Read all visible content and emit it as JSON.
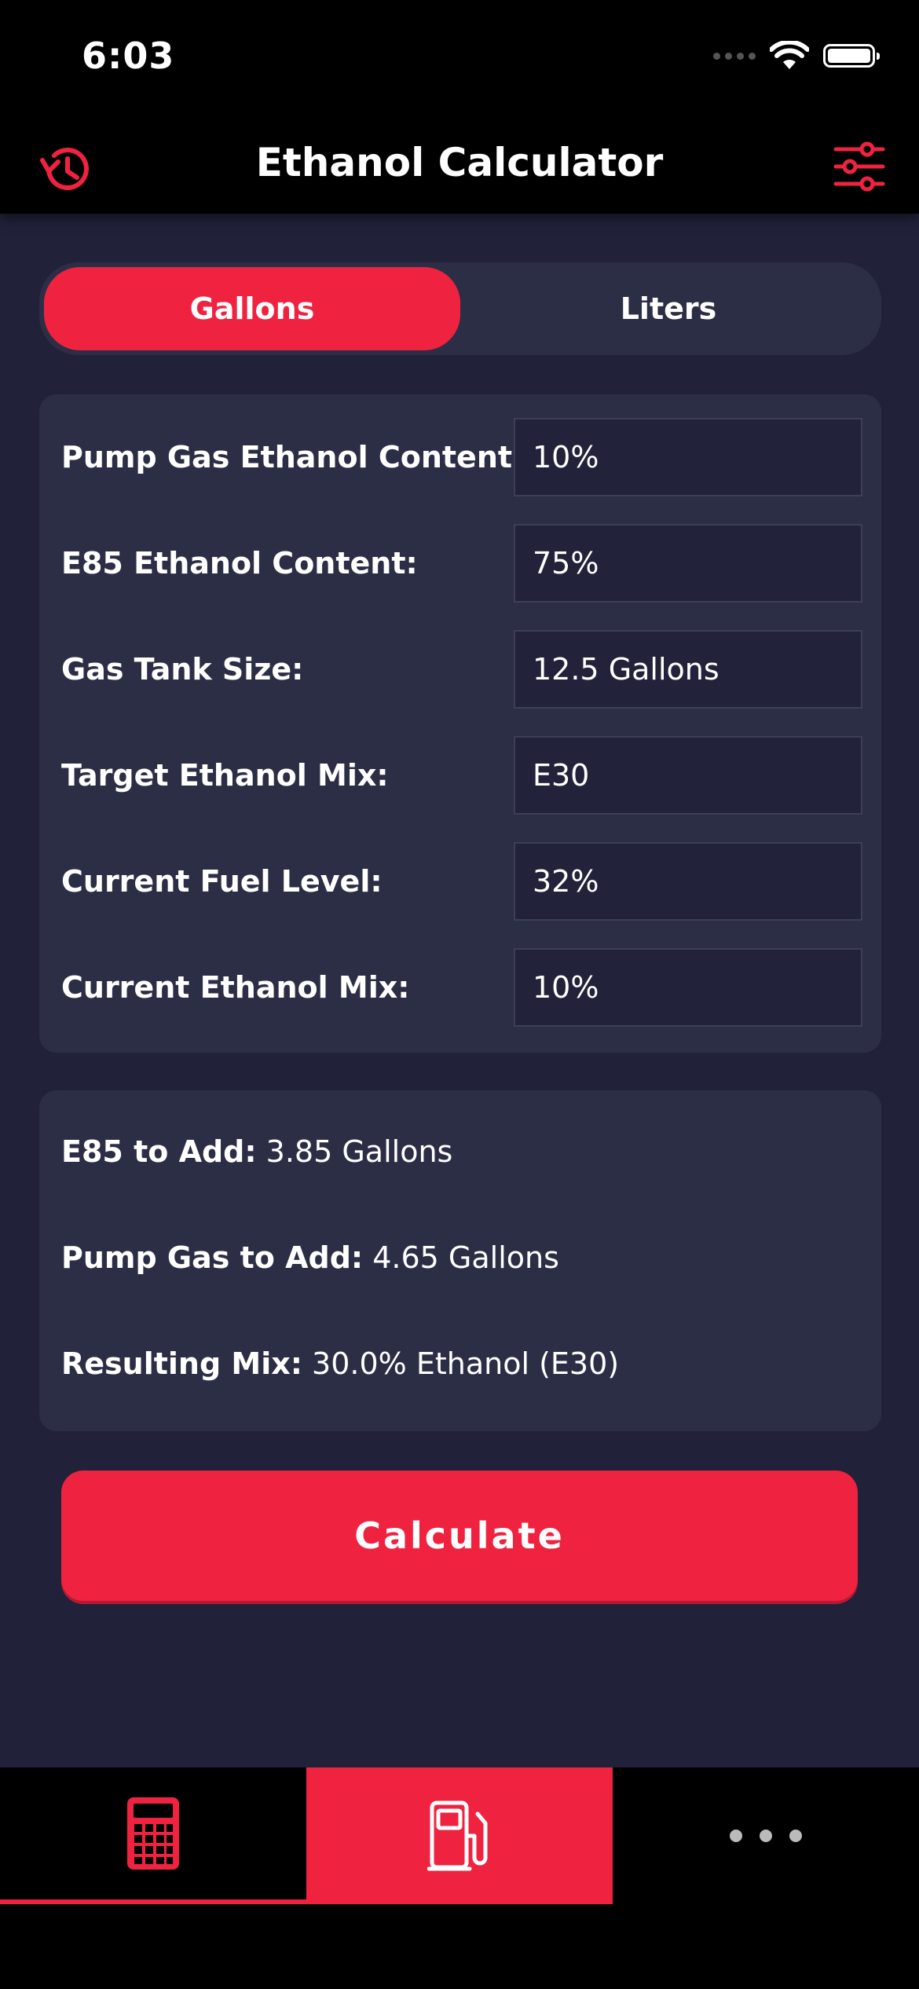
{
  "status_bar": {
    "time": "6:03"
  },
  "nav": {
    "title": "Ethanol Calculator"
  },
  "units": {
    "left": "Gallons",
    "right": "Liters",
    "selected": "Gallons"
  },
  "inputs": [
    {
      "label": "Pump Gas Ethanol Content:",
      "value": "10%"
    },
    {
      "label": "E85 Ethanol Content:",
      "value": "75%"
    },
    {
      "label": "Gas Tank Size:",
      "value": "12.5 Gallons"
    },
    {
      "label": "Target Ethanol Mix:",
      "value": "E30"
    },
    {
      "label": "Current Fuel Level:",
      "value": "32%"
    },
    {
      "label": "Current Ethanol Mix:",
      "value": "10%"
    }
  ],
  "results": {
    "e85_label": "E85 to Add:",
    "e85_value": "3.85 Gallons",
    "pump_label": "Pump Gas to Add:",
    "pump_value": "4.65 Gallons",
    "mix_label": "Resulting Mix:",
    "mix_value": "30.0% Ethanol (E30)"
  },
  "calculate_label": "Calculate",
  "colors": {
    "accent": "#ef2340",
    "background": "#21223a",
    "card": "#2c2e45"
  },
  "tabs": [
    {
      "icon": "calculator-icon"
    },
    {
      "icon": "fuel-pump-icon",
      "active": true
    },
    {
      "icon": "more-icon"
    }
  ]
}
